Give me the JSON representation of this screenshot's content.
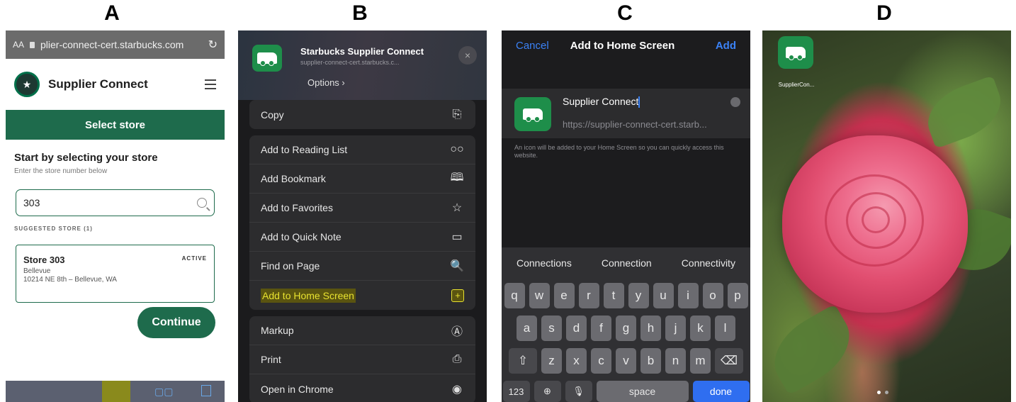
{
  "panel_letters": [
    "A",
    "B",
    "C",
    "D"
  ],
  "panelA": {
    "url_aa": "AA",
    "url_text": "plier-connect-cert.starbucks.com",
    "site_title": "Supplier Connect",
    "select_store": "Select store",
    "heading": "Start by selecting your store",
    "subheading": "Enter the store number below",
    "search_value": "303",
    "suggested_label": "SUGGESTED STORE (1)",
    "store_name": "Store 303",
    "store_status": "ACTIVE",
    "store_city": "Bellevue",
    "store_address": "10214 NE 8th – Bellevue, WA",
    "continue_label": "Continue"
  },
  "panelB": {
    "app_title": "Starbucks Supplier Connect",
    "app_url": "supplier-connect-cert.starbucks.c...",
    "options_label": "Options ›",
    "close_icon": "×",
    "groups": [
      [
        {
          "label": "Copy",
          "icon": "⎘",
          "icon_name": "copy-icon"
        }
      ],
      [
        {
          "label": "Add to Reading List",
          "icon": "○○",
          "icon_name": "glasses-icon"
        },
        {
          "label": "Add Bookmark",
          "icon": "🕮",
          "icon_name": "book-icon"
        },
        {
          "label": "Add to Favorites",
          "icon": "☆",
          "icon_name": "star-icon"
        },
        {
          "label": "Add to Quick Note",
          "icon": "▭",
          "icon_name": "quick-note-icon"
        },
        {
          "label": "Find on Page",
          "icon": "🔍",
          "icon_name": "find-icon"
        },
        {
          "label": "Add to Home Screen",
          "icon": "+",
          "icon_name": "add-square-icon",
          "highlighted": true
        }
      ],
      [
        {
          "label": "Markup",
          "icon": "Ⓐ",
          "icon_name": "markup-icon"
        },
        {
          "label": "Print",
          "icon": "⎙",
          "icon_name": "printer-icon"
        },
        {
          "label": "Open in Chrome",
          "icon": "◉",
          "icon_name": "chrome-icon"
        }
      ]
    ]
  },
  "panelC": {
    "cancel": "Cancel",
    "title": "Add to Home Screen",
    "add": "Add",
    "name_value": "Supplier Connect",
    "url_value": "https://supplier-connect-cert.starb...",
    "note": "An icon will be added to your Home Screen so you can quickly access this website.",
    "suggestions": [
      "Connections",
      "Connection",
      "Connectivity"
    ],
    "row1": [
      "q",
      "w",
      "e",
      "r",
      "t",
      "y",
      "u",
      "i",
      "o",
      "p"
    ],
    "row2": [
      "a",
      "s",
      "d",
      "f",
      "g",
      "h",
      "j",
      "k",
      "l"
    ],
    "row3": [
      "z",
      "x",
      "c",
      "v",
      "b",
      "n",
      "m"
    ],
    "key_123": "123",
    "key_space": "space",
    "key_done": "done"
  },
  "panelD": {
    "app_label": "SupplierCon..."
  }
}
